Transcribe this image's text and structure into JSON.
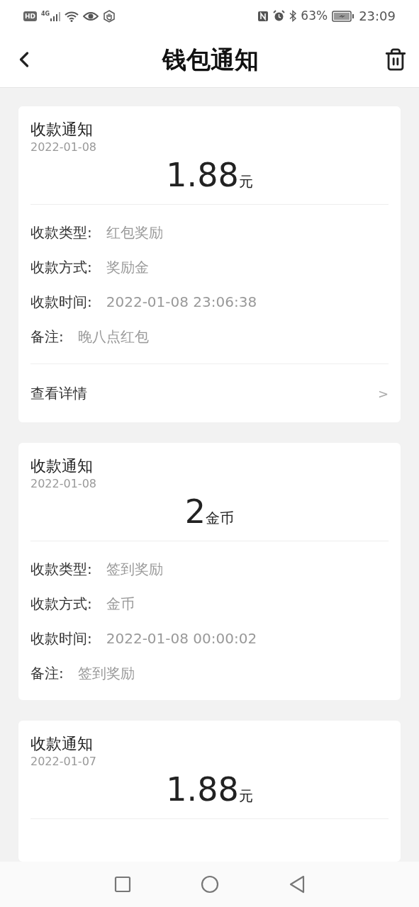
{
  "status_bar": {
    "hd": "HD",
    "network": "4G",
    "battery": "63%",
    "time": "23:09"
  },
  "header": {
    "title": "钱包通知"
  },
  "notifications": [
    {
      "title": "收款通知",
      "date": "2022-01-08",
      "amount": "1.88",
      "unit": "元",
      "fields": [
        {
          "label": "收款类型:",
          "value": "红包奖励"
        },
        {
          "label": "收款方式:",
          "value": "奖励金"
        },
        {
          "label": "收款时间:",
          "value": "2022-01-08 23:06:38"
        },
        {
          "label": "备注:",
          "value": "晚八点红包"
        }
      ],
      "link": {
        "label": "查看详情",
        "arrow": ">"
      }
    },
    {
      "title": "收款通知",
      "date": "2022-01-08",
      "amount": "2",
      "unit": "金币",
      "fields": [
        {
          "label": "收款类型:",
          "value": "签到奖励"
        },
        {
          "label": "收款方式:",
          "value": "金币"
        },
        {
          "label": "收款时间:",
          "value": "2022-01-08 00:00:02"
        },
        {
          "label": "备注:",
          "value": "签到奖励"
        }
      ]
    },
    {
      "title": "收款通知",
      "date": "2022-01-07",
      "amount": "1.88",
      "unit": "元"
    }
  ]
}
